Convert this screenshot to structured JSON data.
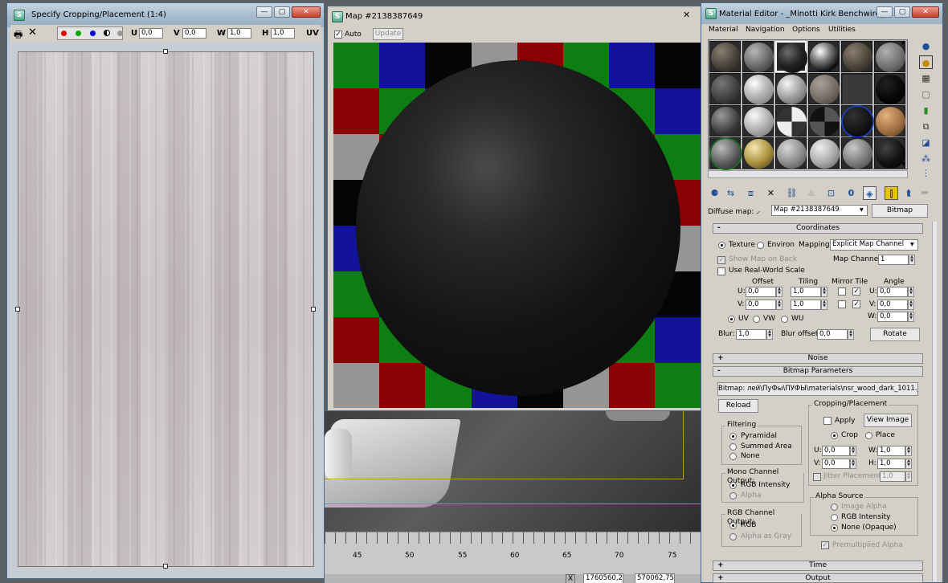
{
  "crop_window": {
    "title": "Specify Cropping/Placement (1:4)",
    "toolbar": {
      "u_label": "U",
      "u_value": "0,0",
      "v_label": "V",
      "v_value": "0,0",
      "w_label": "W",
      "w_value": "1,0",
      "h_label": "H",
      "h_value": "1,0",
      "uv_label": "UV"
    },
    "window_buttons": {
      "minimize": "—",
      "maximize": "▢",
      "close": "✕"
    }
  },
  "map_window": {
    "title": "Map #2138387649",
    "auto_label": "Auto",
    "update_label": "Update",
    "close": "✕"
  },
  "viewport": {
    "ruler_ticks": [
      "45",
      "50",
      "55",
      "60",
      "65",
      "70",
      "75"
    ],
    "coord_x": "1760560,2",
    "coord_y": "570062,75",
    "lock_label": "X"
  },
  "mat_editor": {
    "title": "Material Editor - _Minotti Kirk Benchwire_...",
    "window_buttons": {
      "minimize": "—",
      "maximize": "▢",
      "close": "✕"
    },
    "menu": [
      "Material",
      "Navigation",
      "Options",
      "Utilities"
    ],
    "diffuse_label": "Diffuse map:",
    "map_name": "Map #2138387649",
    "map_type": "Bitmap",
    "coordinates": {
      "header": "Coordinates",
      "texture_label": "Texture",
      "environ_label": "Environ",
      "mapping_label": "Mapping:",
      "mapping_value": "Explicit Map Channel",
      "show_map_label": "Show Map on Back",
      "map_channel_label": "Map Channel:",
      "map_channel_value": "1",
      "real_world_label": "Use Real-World Scale",
      "offset_label": "Offset",
      "tiling_label": "Tiling",
      "mirror_tile_label": "Mirror Tile",
      "angle_label": "Angle",
      "u_label": "U:",
      "v_label": "V:",
      "w_label": "W:",
      "u_offset": "0,0",
      "v_offset": "0,0",
      "u_tiling": "1,0",
      "v_tiling": "1,0",
      "u_angle": "0,0",
      "v_angle": "0,0",
      "w_angle": "0,0",
      "uv_label": "UV",
      "vw_label": "VW",
      "wu_label": "WU",
      "blur_label": "Blur:",
      "blur_value": "1,0",
      "blur_offset_label": "Blur offset:",
      "blur_offset_value": "0,0",
      "rotate_label": "Rotate"
    },
    "noise_header": "Noise",
    "bitmap_params": {
      "header": "Bitmap Parameters",
      "bitmap_path": "Bitmap: лей\\ПуФы\\ПУФЫ\\materials\\nsr_wood_dark_1011.jpg",
      "reload_label": "Reload",
      "filtering_title": "Filtering",
      "pyramidal_label": "Pyramidal",
      "summed_label": "Summed Area",
      "none_label": "None",
      "mono_title": "Mono Channel Output:",
      "rgb_intensity_label": "RGB Intensity",
      "alpha_label": "Alpha",
      "rgb_title": "RGB Channel Output:",
      "rgb_label": "RGB",
      "alpha_gray_label": "Alpha as Gray",
      "crop_title": "Cropping/Placement",
      "apply_label": "Apply",
      "view_image_label": "View Image",
      "crop_label": "Crop",
      "place_label": "Place",
      "u_label": "U:",
      "v_label": "V:",
      "w_label": "W:",
      "h_label": "H:",
      "u_value": "0,0",
      "v_value": "0,0",
      "w_value": "1,0",
      "h_value": "1,0",
      "jitter_label": "Jitter Placement:",
      "jitter_value": "1,0",
      "alpha_source_title": "Alpha Source",
      "image_alpha_label": "Image Alpha",
      "rgb_int_label": "RGB Intensity",
      "none_opaque_label": "None (Opaque)",
      "premult_label": "Premultiplied Alpha"
    },
    "time_header": "Time",
    "output_header": "Output"
  }
}
